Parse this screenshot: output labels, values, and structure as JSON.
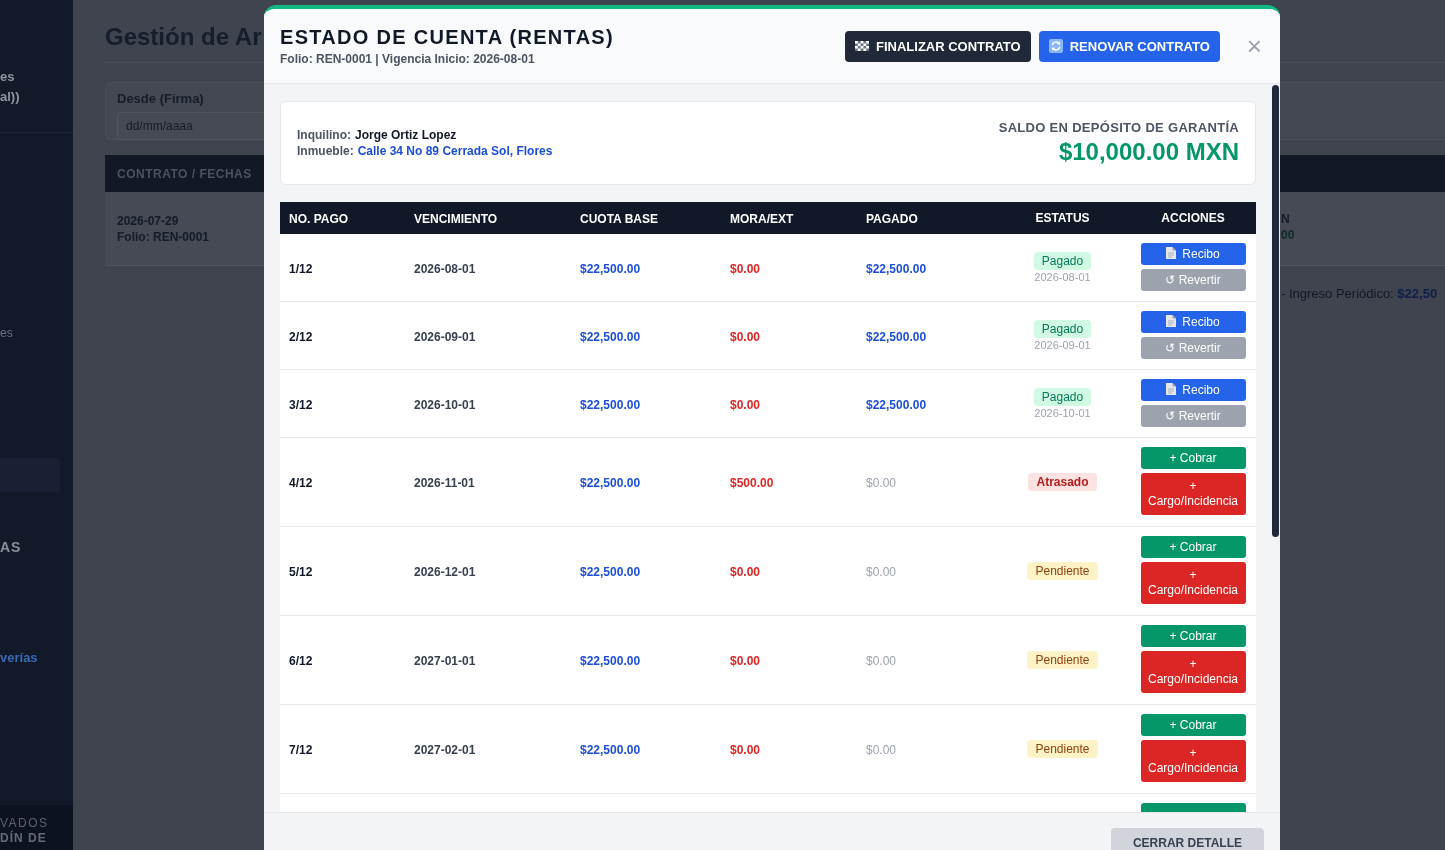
{
  "sidebar": {
    "brand_lines": [
      "es",
      "al))"
    ],
    "entries": [
      {
        "kind": "item",
        "label": "es",
        "selected": false
      },
      {
        "kind": "item",
        "selected": true
      },
      {
        "kind": "section",
        "label": "AS"
      },
      {
        "kind": "link",
        "label": "verías",
        "selected": false
      }
    ],
    "footer_lines": [
      "VADOS",
      "DÍN DE"
    ]
  },
  "page": {
    "title": "Gestión de Ar",
    "filter": {
      "label": "Desde (Firma)",
      "placeholder": "dd/mm/aaaa"
    },
    "table": {
      "columns": [
        "CONTRATO / FECHAS"
      ],
      "rows": [
        {
          "date": "2026-07-29",
          "folio": "Folio: REN-0001",
          "column_3_lines": [
            "N",
            "00"
          ]
        }
      ]
    },
    "note": "- Ingreso Periódico: **$22,50**"
  },
  "modal": {
    "title": "ESTADO DE CUENTA (RENTAS)",
    "subtitle": "Folio: REN-0001 | Vigencia Inicio: 2026-08-01",
    "header_buttons": [
      {
        "kind": "finalize",
        "label": "FINALIZAR CONTRATO"
      },
      {
        "kind": "renew",
        "label": "RENOVAR CONTRATO"
      }
    ],
    "close": "×",
    "tenant": {
      "label": "Inquilino:",
      "value": "Jorge Ortiz Lopez"
    },
    "property": {
      "label": "Inmueble:",
      "value": "Calle 34 No 89 Cerrada Sol, Flores"
    },
    "deposit": {
      "label": "SALDO EN DEPÓSITO DE GARANTÍA",
      "amount": "$10,000.00 MXN"
    },
    "table": {
      "columns": [
        "NO. PAGO",
        "VENCIMIENTO",
        "CUOTA BASE",
        "MORA/EXT",
        "PAGADO",
        "ESTATUS",
        "ACCIONES"
      ],
      "rows": [
        {
          "number": "1/12",
          "due": "2026-08-01",
          "base": "$22,500.00",
          "late_fee": "$0.00",
          "paid": "$22,500.00",
          "status": {
            "kind": "paid",
            "label": "Pagado",
            "date": "2026-08-01"
          },
          "actions": [
            {
              "kind": "receipt",
              "label": "Recibo"
            },
            {
              "kind": "revert",
              "label": "↺ Revertir"
            }
          ]
        },
        {
          "number": "2/12",
          "due": "2026-09-01",
          "base": "$22,500.00",
          "late_fee": "$0.00",
          "paid": "$22,500.00",
          "status": {
            "kind": "paid",
            "label": "Pagado",
            "date": "2026-09-01"
          },
          "actions": [
            {
              "kind": "receipt",
              "label": "Recibo"
            },
            {
              "kind": "revert",
              "label": "↺ Revertir"
            }
          ]
        },
        {
          "number": "3/12",
          "due": "2026-10-01",
          "base": "$22,500.00",
          "late_fee": "$0.00",
          "paid": "$22,500.00",
          "status": {
            "kind": "paid",
            "label": "Pagado",
            "date": "2026-10-01"
          },
          "actions": [
            {
              "kind": "receipt",
              "label": "Recibo"
            },
            {
              "kind": "revert",
              "label": "↺ Revertir"
            }
          ]
        },
        {
          "number": "4/12",
          "due": "2026-11-01",
          "base": "$22,500.00",
          "late_fee": "$500.00",
          "paid": "$0.00",
          "status": {
            "kind": "late",
            "label": "Atrasado"
          },
          "actions": [
            {
              "kind": "charge",
              "label": "+ Cobrar"
            },
            {
              "kind": "incident",
              "label": "+ Cargo/Incidencia"
            }
          ]
        },
        {
          "number": "5/12",
          "due": "2026-12-01",
          "base": "$22,500.00",
          "late_fee": "$0.00",
          "paid": "$0.00",
          "status": {
            "kind": "pending",
            "label": "Pendiente"
          },
          "actions": [
            {
              "kind": "charge",
              "label": "+ Cobrar"
            },
            {
              "kind": "incident",
              "label": "+ Cargo/Incidencia"
            }
          ]
        },
        {
          "number": "6/12",
          "due": "2027-01-01",
          "base": "$22,500.00",
          "late_fee": "$0.00",
          "paid": "$0.00",
          "status": {
            "kind": "pending",
            "label": "Pendiente"
          },
          "actions": [
            {
              "kind": "charge",
              "label": "+ Cobrar"
            },
            {
              "kind": "incident",
              "label": "+ Cargo/Incidencia"
            }
          ]
        },
        {
          "number": "7/12",
          "due": "2027-02-01",
          "base": "$22,500.00",
          "late_fee": "$0.00",
          "paid": "$0.00",
          "status": {
            "kind": "pending",
            "label": "Pendiente"
          },
          "actions": [
            {
              "kind": "charge",
              "label": "+ Cobrar"
            },
            {
              "kind": "incident",
              "label": "+ Cargo/Incidencia"
            }
          ]
        }
      ],
      "more_rows_below": true
    },
    "footer_button": "CERRAR DETALLE"
  }
}
